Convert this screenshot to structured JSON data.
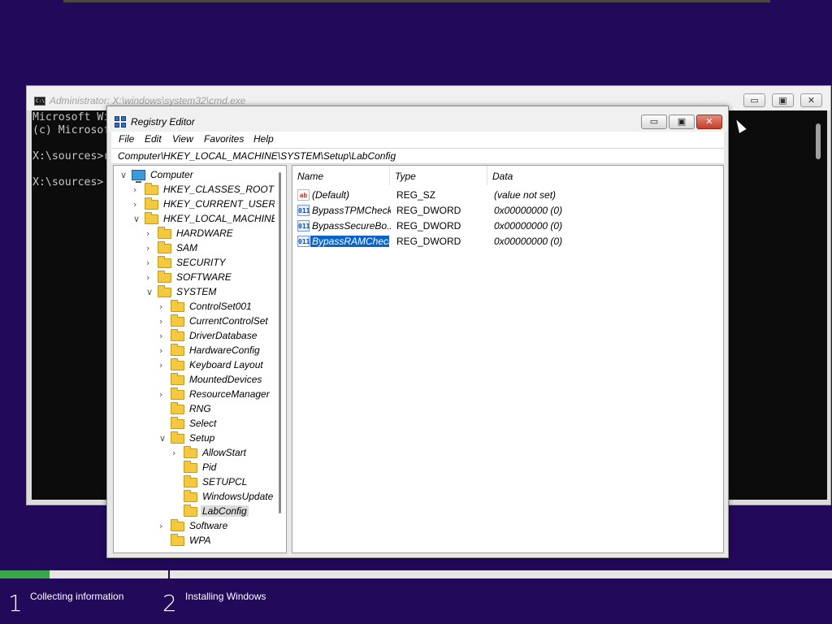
{
  "cmd": {
    "title": "Administrator: X:\\windows\\system32\\cmd.exe",
    "lines": [
      "Microsoft Wi",
      "(c) Microsof",
      "",
      "X:\\sources>r",
      "",
      "X:\\sources>"
    ],
    "buttons": {
      "minimize": "▭",
      "maximize": "▣",
      "close": "✕"
    }
  },
  "regedit": {
    "title": "Registry Editor",
    "buttons": {
      "minimize": "▭",
      "maximize": "▣",
      "close": "✕"
    },
    "menu": [
      "File",
      "Edit",
      "View",
      "Favorites",
      "Help"
    ],
    "address": "Computer\\HKEY_LOCAL_MACHINE\\SYSTEM\\Setup\\LabConfig",
    "tree": [
      {
        "label": "Computer",
        "expander": "∨",
        "icon": "computer-icon",
        "depth": 0
      },
      {
        "label": "HKEY_CLASSES_ROOT",
        "expander": "›",
        "icon": "folder-icon",
        "depth": 1
      },
      {
        "label": "HKEY_CURRENT_USER",
        "expander": "›",
        "icon": "folder-icon",
        "depth": 1
      },
      {
        "label": "HKEY_LOCAL_MACHINE",
        "expander": "∨",
        "icon": "folder-icon",
        "depth": 1
      },
      {
        "label": "HARDWARE",
        "expander": "›",
        "icon": "folder-icon",
        "depth": 2
      },
      {
        "label": "SAM",
        "expander": "›",
        "icon": "folder-icon",
        "depth": 2
      },
      {
        "label": "SECURITY",
        "expander": "›",
        "icon": "folder-icon",
        "depth": 2
      },
      {
        "label": "SOFTWARE",
        "expander": "›",
        "icon": "folder-icon",
        "depth": 2
      },
      {
        "label": "SYSTEM",
        "expander": "∨",
        "icon": "folder-icon",
        "depth": 2
      },
      {
        "label": "ControlSet001",
        "expander": "›",
        "icon": "folder-icon",
        "depth": 3
      },
      {
        "label": "CurrentControlSet",
        "expander": "›",
        "icon": "folder-icon",
        "depth": 3
      },
      {
        "label": "DriverDatabase",
        "expander": "›",
        "icon": "folder-icon",
        "depth": 3
      },
      {
        "label": "HardwareConfig",
        "expander": "›",
        "icon": "folder-icon",
        "depth": 3
      },
      {
        "label": "Keyboard Layout",
        "expander": "›",
        "icon": "folder-icon",
        "depth": 3
      },
      {
        "label": "MountedDevices",
        "expander": "",
        "icon": "folder-icon",
        "depth": 3
      },
      {
        "label": "ResourceManager",
        "expander": "›",
        "icon": "folder-icon",
        "depth": 3
      },
      {
        "label": "RNG",
        "expander": "",
        "icon": "folder-icon",
        "depth": 3
      },
      {
        "label": "Select",
        "expander": "",
        "icon": "folder-icon",
        "depth": 3
      },
      {
        "label": "Setup",
        "expander": "∨",
        "icon": "folder-icon",
        "depth": 3
      },
      {
        "label": "AllowStart",
        "expander": "›",
        "icon": "folder-icon",
        "depth": 4
      },
      {
        "label": "Pid",
        "expander": "",
        "icon": "folder-icon",
        "depth": 4
      },
      {
        "label": "SETUPCL",
        "expander": "",
        "icon": "folder-icon",
        "depth": 4
      },
      {
        "label": "WindowsUpdate",
        "expander": "",
        "icon": "folder-icon",
        "depth": 4
      },
      {
        "label": "LabConfig",
        "expander": "",
        "icon": "folder-open-icon",
        "depth": 4,
        "selected": true
      },
      {
        "label": "Software",
        "expander": "›",
        "icon": "folder-icon",
        "depth": 3
      },
      {
        "label": "WPA",
        "expander": "",
        "icon": "folder-icon",
        "depth": 3
      }
    ],
    "columns": {
      "name": "Name",
      "type": "Type",
      "data": "Data"
    },
    "values": [
      {
        "name": "(Default)",
        "type": "REG_SZ",
        "data": "(value not set)",
        "icon": "string-value-icon",
        "icon_text": "ab"
      },
      {
        "name": "BypassTPMCheck",
        "type": "REG_DWORD",
        "data": "0x00000000 (0)",
        "icon": "binary-value-icon",
        "icon_text": "011"
      },
      {
        "name": "BypassSecureBo...",
        "type": "REG_DWORD",
        "data": "0x00000000 (0)",
        "icon": "binary-value-icon",
        "icon_text": "011"
      },
      {
        "name": "BypassRAMCheck",
        "type": "REG_DWORD",
        "data": "0x00000000 (0)",
        "icon": "binary-value-icon",
        "icon_text": "011",
        "selected": true
      }
    ]
  },
  "setup": {
    "progress": 0.06,
    "steps": [
      {
        "num": "1",
        "label": "Collecting information"
      },
      {
        "num": "2",
        "label": "Installing Windows"
      }
    ],
    "colors": {
      "background": "#22095a",
      "progress": "#3aa64a"
    }
  }
}
